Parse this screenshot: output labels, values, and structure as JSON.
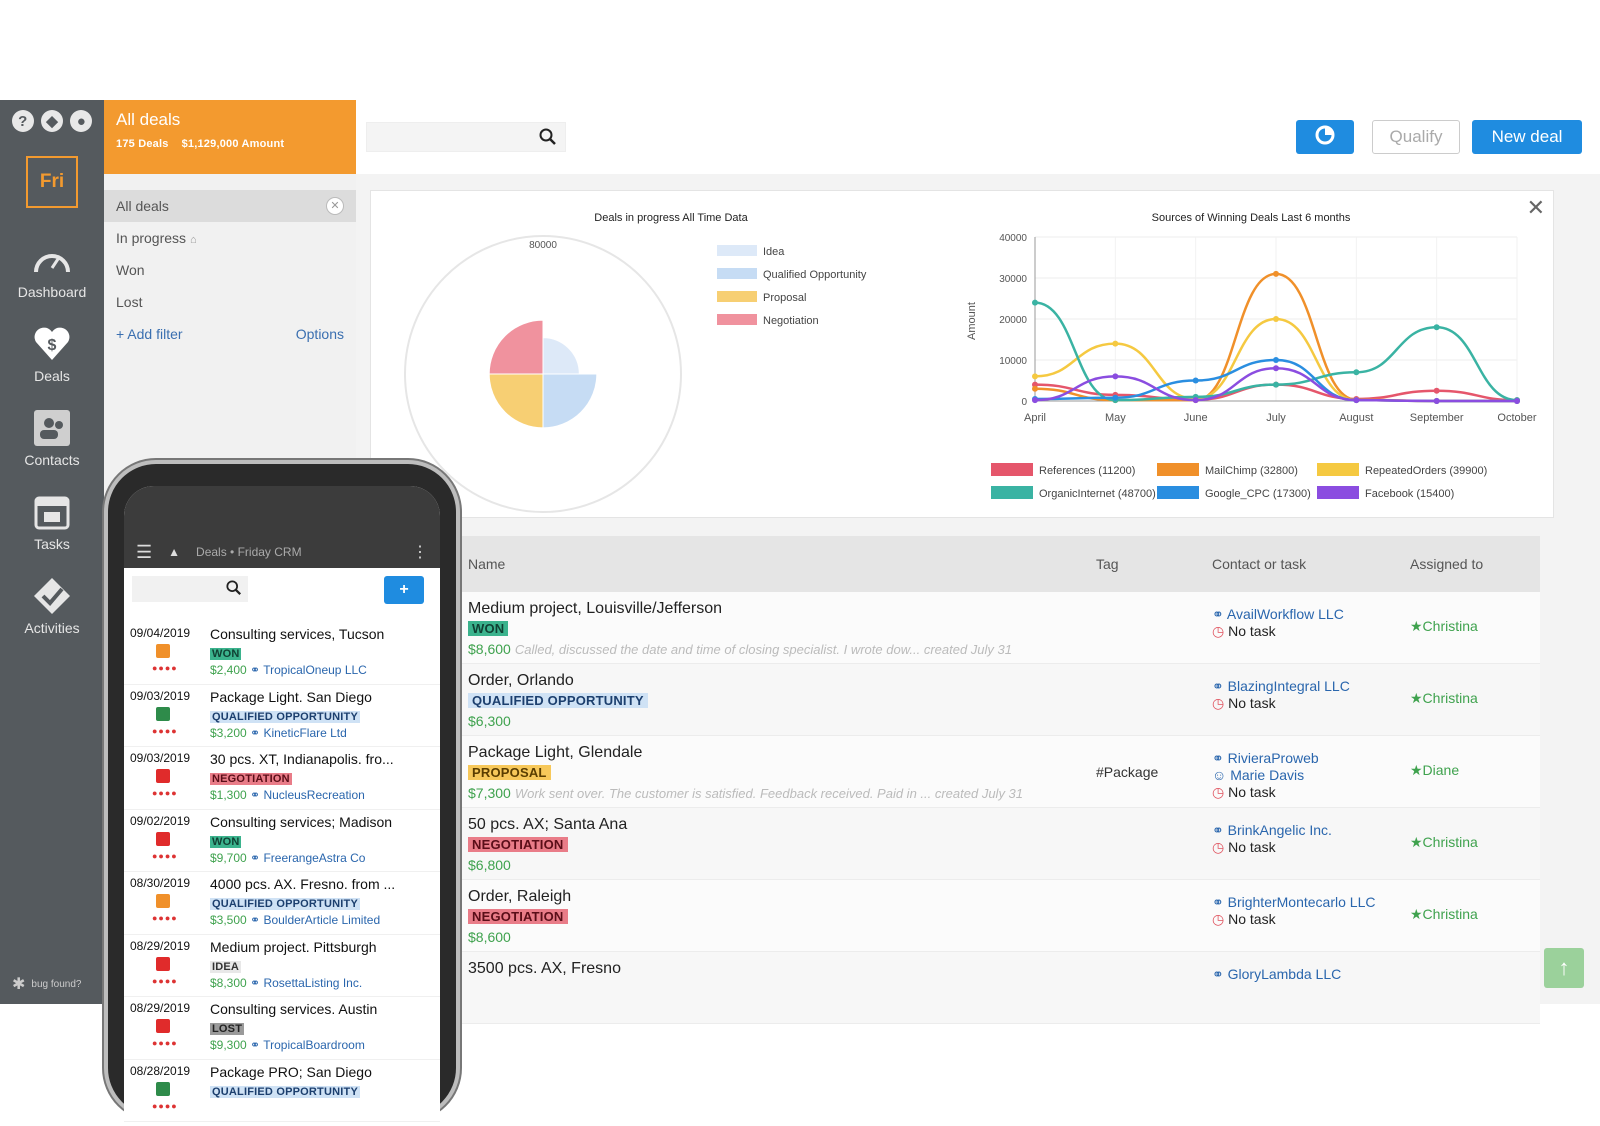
{
  "nav": {
    "top_icons": [
      "help-icon",
      "bell-icon",
      "user-icon"
    ],
    "logo": "Fri",
    "items": [
      {
        "label": "Dashboard",
        "icon": "gauge-icon"
      },
      {
        "label": "Deals",
        "icon": "dollar-heart-icon"
      },
      {
        "label": "Contacts",
        "icon": "contacts-icon"
      },
      {
        "label": "Tasks",
        "icon": "calendar-icon"
      },
      {
        "label": "Activities",
        "icon": "check-icon"
      }
    ],
    "bug": "bug found?"
  },
  "deals_header": {
    "title": "All deals",
    "count": "175 Deals",
    "amount": "$1,129,000 Amount"
  },
  "filters": {
    "items": [
      "All deals",
      "In progress",
      "Won",
      "Lost"
    ],
    "add_filter": "Add filter",
    "options": "Options"
  },
  "toolbar": {
    "qualify": "Qualify",
    "new_deal": "New deal"
  },
  "colors": {
    "orange": "#f39a2f",
    "blue": "#1f8ce0",
    "green": "#3fa24e"
  },
  "chart_data": [
    {
      "type": "pie",
      "title": "Deals in progress All Time Data",
      "radial_ticks": [
        "80000"
      ],
      "categories": [
        "Idea",
        "Qualified Opportunity",
        "Proposal",
        "Negotiation"
      ],
      "values": [
        27000,
        40000,
        40000,
        40000
      ],
      "colors": [
        "#dde9f8",
        "#c6dcf4",
        "#f7cf73",
        "#f0929e"
      ]
    },
    {
      "type": "line",
      "title": "Sources of Winning Deals Last 6 months",
      "ylabel": "Amount",
      "ylim": [
        0,
        40000
      ],
      "yticks": [
        0,
        10000,
        20000,
        30000,
        40000
      ],
      "x": [
        "April",
        "May",
        "June",
        "July",
        "August",
        "September",
        "October"
      ],
      "series": [
        {
          "name": "References (11200)",
          "color": "#e5566b",
          "values": [
            4000,
            1500,
            300,
            4000,
            500,
            2500,
            200
          ]
        },
        {
          "name": "MailChimp (32800)",
          "color": "#f0902a",
          "values": [
            3000,
            200,
            200,
            31000,
            300,
            0,
            0
          ]
        },
        {
          "name": "RepeatedOrders (39900)",
          "color": "#f5c941",
          "values": [
            6000,
            14000,
            500,
            20000,
            200,
            0,
            0
          ]
        },
        {
          "name": "OrganicInternet (48700)",
          "color": "#3ab3a3",
          "values": [
            24000,
            200,
            1000,
            4000,
            7000,
            18000,
            200
          ]
        },
        {
          "name": "Google_CPC (17300)",
          "color": "#2a8ee0",
          "values": [
            500,
            800,
            5000,
            10000,
            200,
            0,
            0
          ]
        },
        {
          "name": "Facebook (15400)",
          "color": "#8b4de0",
          "values": [
            200,
            6000,
            200,
            8000,
            200,
            0,
            0
          ]
        }
      ]
    }
  ],
  "table": {
    "headers": [
      "Name",
      "Tag",
      "Contact or task",
      "Assigned to"
    ],
    "rows": [
      {
        "name": "Medium project, Louisville/Jefferson",
        "stage": "WON",
        "amount": "$8,600",
        "note": "Called, discussed the date and time of closing specialist. I wrote dow... created July 31",
        "tag": "",
        "contacts": [
          "AvailWorkflow LLC"
        ],
        "task": "No task",
        "assigned": "★Christina"
      },
      {
        "name": "Order, Orlando",
        "stage": "QUALIFIED OPPORTUNITY",
        "amount": "$6,300",
        "note": "",
        "tag": "",
        "contacts": [
          "BlazingIntegral LLC"
        ],
        "task": "No task",
        "assigned": "★Christina"
      },
      {
        "name": "Package Light, Glendale",
        "stage": "PROPOSAL",
        "amount": "$7,300",
        "note": "Work sent over. The customer is satisfied. Feedback received. Paid in ... created July 31",
        "tag": "#Package",
        "contacts": [
          "RivieraProweb",
          "Marie Davis"
        ],
        "task": "No task",
        "assigned": "★Diane"
      },
      {
        "name": "50 pcs. AX; Santa Ana",
        "stage": "NEGOTIATION",
        "amount": "$6,800",
        "note": "",
        "tag": "",
        "contacts": [
          "BrinkAngelic Inc."
        ],
        "task": "No task",
        "assigned": "★Christina"
      },
      {
        "name": "Order, Raleigh",
        "stage": "NEGOTIATION",
        "amount": "$8,600",
        "note": "",
        "tag": "",
        "contacts": [
          "BrighterMontecarlo LLC"
        ],
        "task": "No task",
        "assigned": "★Christina"
      },
      {
        "name": "3500 pcs. AX, Fresno",
        "stage": "",
        "amount": "",
        "note": "",
        "tag": "",
        "contacts": [
          "GloryLambda LLC"
        ],
        "task": "",
        "assigned": ""
      }
    ]
  },
  "phone": {
    "title": "Deals • Friday CRM",
    "items": [
      {
        "date": "09/04/2019",
        "title": "Consulting services, Tucson",
        "stage": "WON",
        "amount": "$2,400",
        "company": "TropicalOneup LLC",
        "dot": "#f0902a"
      },
      {
        "date": "09/03/2019",
        "title": "Package Light. San Diego",
        "stage": "QUALIFIED OPPORTUNITY",
        "amount": "$3,200",
        "company": "KineticFlare Ltd",
        "dot": "#2e8b4a"
      },
      {
        "date": "09/03/2019",
        "title": "30 pcs. XT, Indianapolis. fro...",
        "stage": "NEGOTIATION",
        "amount": "$1,300",
        "company": "NucleusRecreation",
        "dot": "#e02b2b"
      },
      {
        "date": "09/02/2019",
        "title": "Consulting services; Madison",
        "stage": "WON",
        "amount": "$9,700",
        "company": "FreerangeAstra Co",
        "dot": "#e02b2b"
      },
      {
        "date": "08/30/2019",
        "title": "4000 pcs. AX. Fresno. from ...",
        "stage": "QUALIFIED OPPORTUNITY",
        "amount": "$3,500",
        "company": "BoulderArticle Limited",
        "dot": "#f0902a"
      },
      {
        "date": "08/29/2019",
        "title": "Medium project. Pittsburgh",
        "stage": "IDEA",
        "amount": "$8,300",
        "company": "RosettaListing Inc.",
        "dot": "#e02b2b"
      },
      {
        "date": "08/29/2019",
        "title": "Consulting services. Austin",
        "stage": "LOST",
        "amount": "$9,300",
        "company": "TropicalBoardroom",
        "dot": "#e02b2b"
      },
      {
        "date": "08/28/2019",
        "title": "Package PRO; San Diego",
        "stage": "QUALIFIED OPPORTUNITY",
        "amount": "",
        "company": "",
        "dot": "#2e8b4a"
      }
    ]
  }
}
